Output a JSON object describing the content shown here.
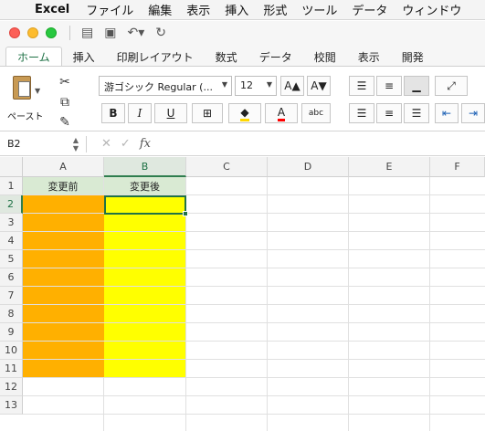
{
  "menubar": {
    "app": "Excel",
    "items": [
      "ファイル",
      "編集",
      "表示",
      "挿入",
      "形式",
      "ツール",
      "データ",
      "ウィンドウ"
    ]
  },
  "ribbon_tabs": [
    "ホーム",
    "挿入",
    "印刷レイアウト",
    "数式",
    "データ",
    "校閲",
    "表示",
    "開発"
  ],
  "ribbon": {
    "paste_label": "ペースト",
    "font_name": "游ゴシック Regular (...",
    "font_size": "12",
    "bold": "B",
    "italic": "I",
    "underline": "U",
    "grow_font": "A▲",
    "shrink_font": "A▼",
    "font_color_glyph": "A",
    "phonetic_glyph": "abc",
    "font_color": "#ff0000",
    "fill_color": "#ffd700"
  },
  "formula_bar": {
    "name_box": "B2",
    "fx": "fx",
    "value": ""
  },
  "columns": [
    "A",
    "B",
    "C",
    "D",
    "E",
    "F"
  ],
  "rows": [
    "1",
    "2",
    "3",
    "4",
    "5",
    "6",
    "7",
    "8",
    "9",
    "10",
    "11",
    "12",
    "13"
  ],
  "cells": {
    "A1": "変更前",
    "B1": "変更後"
  },
  "selection": {
    "cell": "B2",
    "column": "B",
    "row": "2"
  },
  "colors": {
    "accent": "#217346",
    "header_fill": "#d9ead3",
    "orange_fill": "#ffb000",
    "yellow_fill": "#ffff00"
  }
}
